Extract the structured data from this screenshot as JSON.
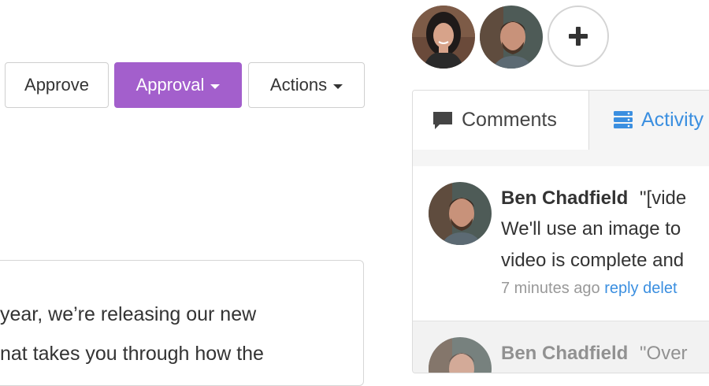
{
  "toolbar": {
    "approve_label": "Approve",
    "approval_label": "Approval",
    "actions_label": "Actions"
  },
  "content": {
    "lines": [
      "year, we’re releasing our new",
      "nat takes you through how the"
    ]
  },
  "members": {
    "add_symbol": "+"
  },
  "tabs": {
    "comments_label": "Comments",
    "activity_label": "Activity"
  },
  "comments": [
    {
      "author": "Ben Chadfield",
      "quote": "\"[vide",
      "lines": [
        "We'll use an image to",
        "video is complete and"
      ],
      "time": "7 minutes ago",
      "reply_label": "reply",
      "delete_label": "delet"
    },
    {
      "author": "Ben Chadfield",
      "quote": "\"Over"
    }
  ],
  "colors": {
    "accent_purple": "#a35fcc",
    "link_blue": "#3b8fe0"
  },
  "icons": {
    "comments_tab": "speech-bubble-icon",
    "activity_tab": "stack-icon",
    "add_member": "plus-icon"
  }
}
